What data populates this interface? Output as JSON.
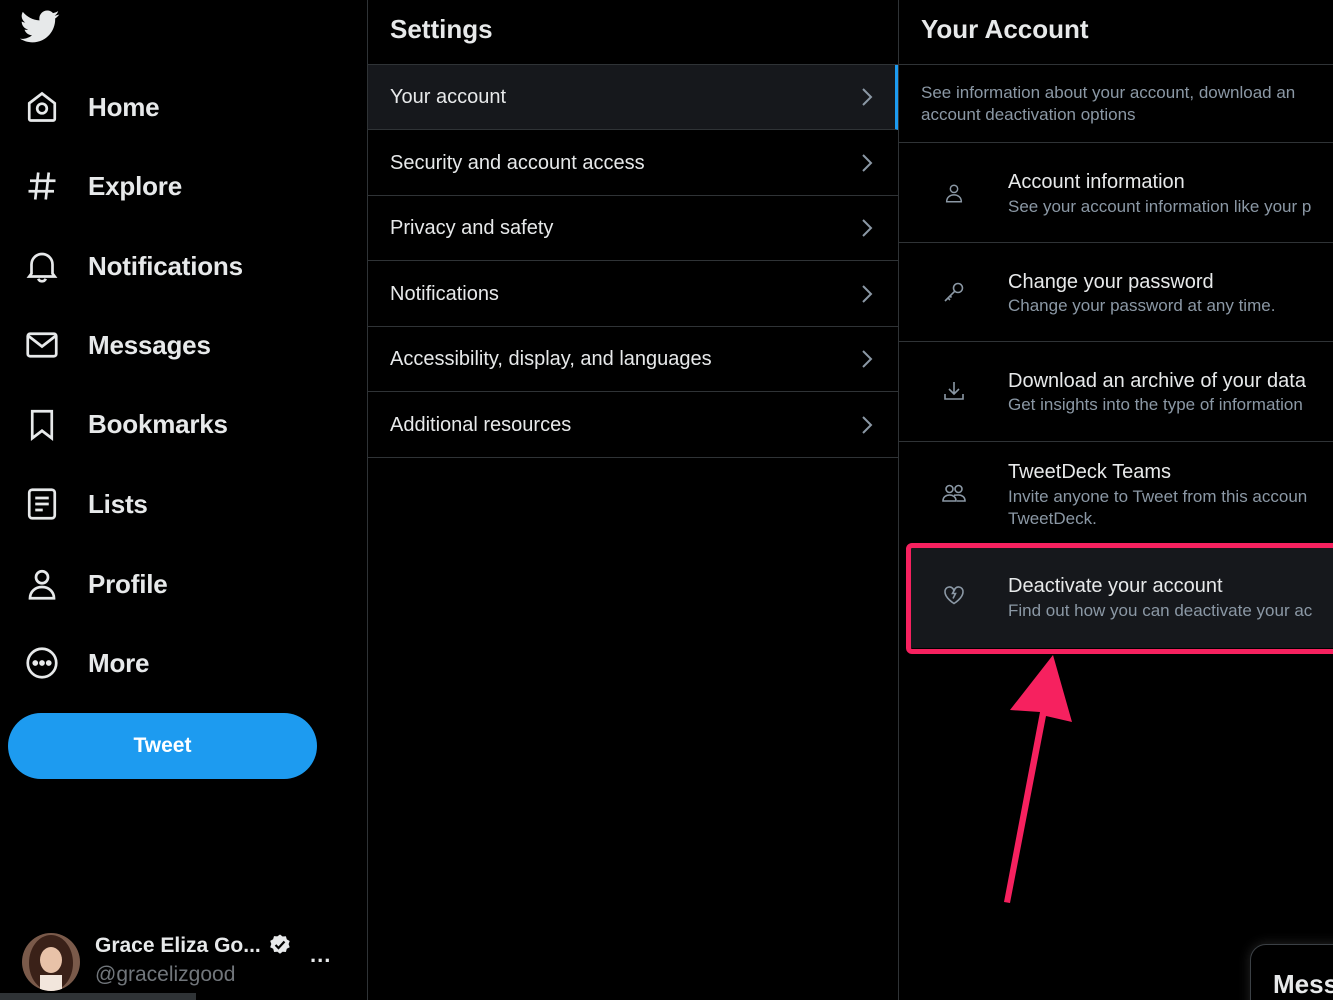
{
  "nav": {
    "logo": "twitter-bird-icon",
    "items": [
      {
        "label": "Home",
        "icon": "home-icon"
      },
      {
        "label": "Explore",
        "icon": "hashtag-icon"
      },
      {
        "label": "Notifications",
        "icon": "bell-icon"
      },
      {
        "label": "Messages",
        "icon": "envelope-icon"
      },
      {
        "label": "Bookmarks",
        "icon": "bookmark-icon"
      },
      {
        "label": "Lists",
        "icon": "list-icon"
      },
      {
        "label": "Profile",
        "icon": "person-icon"
      },
      {
        "label": "More",
        "icon": "more-circle-icon"
      }
    ],
    "tweet_label": "Tweet",
    "user": {
      "name": "Grace Eliza Go...",
      "handle": "@gracelizgood",
      "verified": true,
      "more": "..."
    }
  },
  "settings": {
    "title": "Settings",
    "items": [
      {
        "label": "Your account",
        "active": true
      },
      {
        "label": "Security and account access"
      },
      {
        "label": "Privacy and safety"
      },
      {
        "label": "Notifications"
      },
      {
        "label": "Accessibility, display, and languages"
      },
      {
        "label": "Additional resources"
      }
    ]
  },
  "account": {
    "title": "Your Account",
    "desc_line1": "See information about your account, download an",
    "desc_line2": "account deactivation options",
    "items": [
      {
        "title": "Account information",
        "sub1": "See your account information like your p",
        "icon": "person-icon"
      },
      {
        "title": "Change your password",
        "sub1": "Change your password at any time.",
        "icon": "key-icon"
      },
      {
        "title": "Download an archive of your data",
        "sub1": "Get insights into the type of information",
        "icon": "download-icon"
      },
      {
        "title": "TweetDeck Teams",
        "sub1": "Invite anyone to Tweet from this accoun",
        "sub2": "TweetDeck.",
        "icon": "people-icon"
      },
      {
        "title": "Deactivate your account",
        "sub1": "Find out how you can deactivate your ac",
        "icon": "broken-heart-icon"
      }
    ],
    "messages_drawer": "Mess"
  },
  "colors": {
    "accent": "#1d9bf0",
    "highlight": "#f6215f",
    "background": "#000000",
    "divider": "#2f3336",
    "muted_text": "#8b98a5"
  }
}
